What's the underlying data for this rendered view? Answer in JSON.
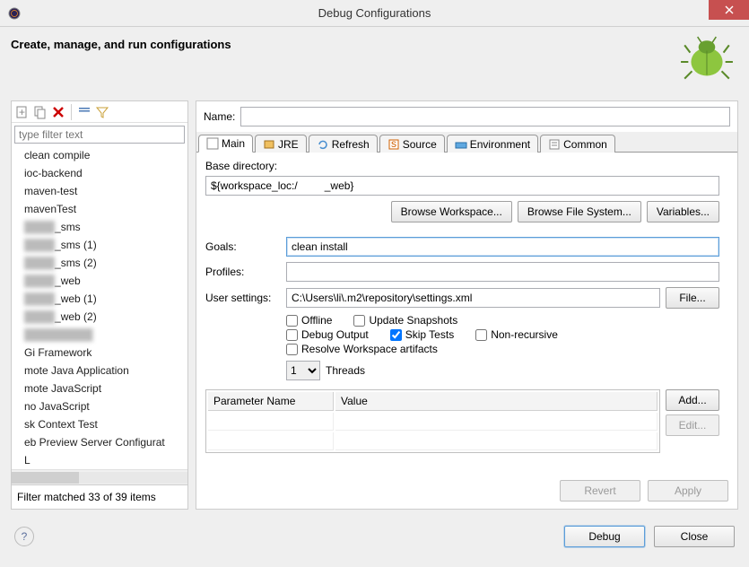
{
  "title": "Debug Configurations",
  "header": "Create, manage, and run configurations",
  "filter_placeholder": "type filter text",
  "configurations": [
    "clean compile",
    "ioc-backend",
    "maven-test",
    "mavenTest",
    "_sms",
    "_sms (1)",
    "_sms (2)",
    "_web",
    "_web (1)",
    "_web (2)",
    "",
    "Gi Framework",
    "mote Java Application",
    "mote JavaScript",
    "no JavaScript",
    "sk Context Test",
    "eb Preview Server Configurat",
    "L"
  ],
  "filter_status": "Filter matched 33 of 39 items",
  "name_label": "Name:",
  "name_value": "",
  "tabs": {
    "main": "Main",
    "jre": "JRE",
    "refresh": "Refresh",
    "source": "Source",
    "environment": "Environment",
    "common": "Common"
  },
  "main_tab": {
    "base_dir_label": "Base directory:",
    "base_dir_value": "${workspace_loc:/         _web}",
    "browse_workspace": "Browse Workspace...",
    "browse_fs": "Browse File System...",
    "variables": "Variables...",
    "goals_label": "Goals:",
    "goals_value": "clean install",
    "profiles_label": "Profiles:",
    "profiles_value": "",
    "user_settings_label": "User settings:",
    "user_settings_value": "C:\\Users\\li\\.m2\\repository\\settings.xml",
    "file_btn": "File...",
    "chk_offline": "Offline",
    "chk_update": "Update Snapshots",
    "chk_debug": "Debug Output",
    "chk_skip": "Skip Tests",
    "chk_nonrec": "Non-recursive",
    "chk_resolve": "Resolve Workspace artifacts",
    "threads_value": "1",
    "threads_label": "Threads",
    "param_col1": "Parameter Name",
    "param_col2": "Value",
    "add_btn": "Add...",
    "edit_btn": "Edit..."
  },
  "footer": {
    "revert": "Revert",
    "apply": "Apply",
    "debug": "Debug",
    "close": "Close"
  }
}
